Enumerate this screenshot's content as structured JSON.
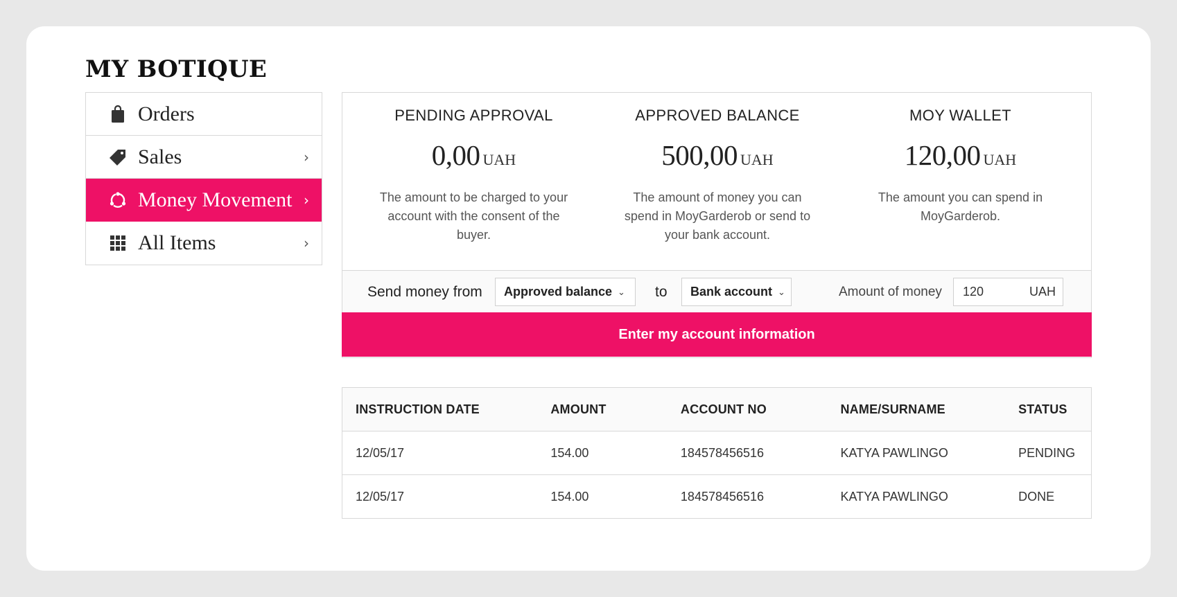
{
  "page": {
    "title": "MY BOTIQUE"
  },
  "colors": {
    "accent": "#ee1166",
    "border": "#d8d8d8"
  },
  "sidebar": {
    "items": [
      {
        "label": "Orders",
        "icon": "shopping-bag-icon",
        "has_chevron": false,
        "active": false
      },
      {
        "label": "Sales",
        "icon": "price-tag-icon",
        "has_chevron": true,
        "active": false
      },
      {
        "label": "Money Movement",
        "icon": "money-cycle-icon",
        "has_chevron": true,
        "active": true
      },
      {
        "label": "All Items",
        "icon": "grid-icon",
        "has_chevron": true,
        "active": false
      }
    ],
    "chevron": "›"
  },
  "balances": [
    {
      "title": "PENDING APPROVAL",
      "amount": "0,00",
      "currency": "UAH",
      "description": "The amount to be charged to your account with the consent of the buyer."
    },
    {
      "title": "APPROVED BALANCE",
      "amount": "500,00",
      "currency": "UAH",
      "description": "The amount of money you can spend in MoyGarderob or send to your bank account."
    },
    {
      "title": "MOY WALLET",
      "amount": "120,00",
      "currency": "UAH",
      "description": "The amount you can spend in MoyGarderob."
    }
  ],
  "transfer": {
    "from_label": "Send money from",
    "from_value": "Approved balance",
    "to_label": "to",
    "to_value": "Bank account",
    "amount_label": "Amount of money",
    "amount_value": "120",
    "amount_currency": "UAH",
    "submit_label": "Enter my account information"
  },
  "table": {
    "columns": [
      "INSTRUCTION DATE",
      "AMOUNT",
      "ACCOUNT NO",
      "NAME/SURNAME",
      "STATUS"
    ],
    "rows": [
      [
        "12/05/17",
        "154.00",
        "184578456516",
        "KATYA PAWLINGO",
        "PENDING"
      ],
      [
        "12/05/17",
        "154.00",
        "184578456516",
        "KATYA PAWLINGO",
        "DONE"
      ]
    ]
  }
}
